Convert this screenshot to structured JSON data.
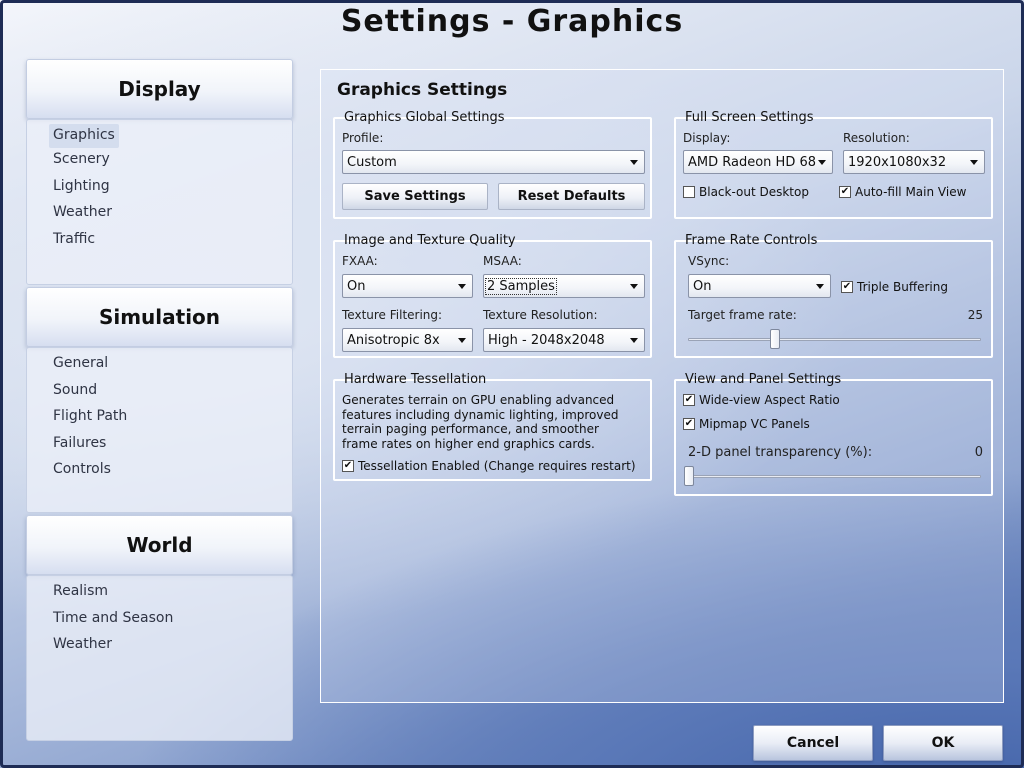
{
  "window": {
    "title": "Settings - Graphics"
  },
  "sidebar": {
    "sections": [
      {
        "header": "Display",
        "items": [
          "Graphics",
          "Scenery",
          "Lighting",
          "Weather",
          "Traffic"
        ]
      },
      {
        "header": "Simulation",
        "items": [
          "General",
          "Sound",
          "Flight Path",
          "Failures",
          "Controls"
        ]
      },
      {
        "header": "World",
        "items": [
          "Realism",
          "Time and Season",
          "Weather"
        ]
      }
    ],
    "active_item": "Graphics"
  },
  "main": {
    "title": "Graphics Settings",
    "global": {
      "label": "Graphics Global Settings",
      "profile_label": "Profile:",
      "profile_value": "Custom",
      "save_button": "Save Settings",
      "reset_button": "Reset Defaults"
    },
    "fullscreen": {
      "label": "Full Screen Settings",
      "display_label": "Display:",
      "display_value": "AMD Radeon HD 68",
      "resolution_label": "Resolution:",
      "resolution_value": "1920x1080x32",
      "blackout_label": "Black-out Desktop",
      "blackout_checked": false,
      "autofill_label": "Auto-fill Main View",
      "autofill_checked": true
    },
    "image_quality": {
      "label": "Image and Texture Quality",
      "fxaa_label": "FXAA:",
      "fxaa_value": "On",
      "msaa_label": "MSAA:",
      "msaa_value": "2 Samples",
      "filtering_label": "Texture Filtering:",
      "filtering_value": "Anisotropic 8x",
      "resolution_label": "Texture Resolution:",
      "resolution_value": "High - 2048x2048"
    },
    "frame_rate": {
      "label": "Frame Rate Controls",
      "vsync_label": "VSync:",
      "vsync_value": "On",
      "triple_label": "Triple Buffering",
      "triple_checked": true,
      "target_label": "Target frame rate:",
      "target_value": "25",
      "target_fraction": 0.29
    },
    "tessellation": {
      "label": "Hardware Tessellation",
      "description": "Generates terrain on GPU enabling advanced features including dynamic lighting, improved terrain paging performance, and smoother frame rates on higher end graphics cards.",
      "enabled_label": "Tessellation Enabled (Change requires restart)",
      "enabled_checked": true
    },
    "view_panel": {
      "label": "View and Panel Settings",
      "wide_label": "Wide-view Aspect Ratio",
      "wide_checked": true,
      "mipmap_label": "Mipmap VC Panels",
      "mipmap_checked": true,
      "transparency_label": "2-D panel transparency (%):",
      "transparency_value": "0",
      "transparency_fraction": 0.0
    }
  },
  "footer": {
    "cancel": "Cancel",
    "ok": "OK"
  },
  "icons": {
    "dropdown": "chevron-down-icon",
    "check": "checkmark-icon"
  }
}
